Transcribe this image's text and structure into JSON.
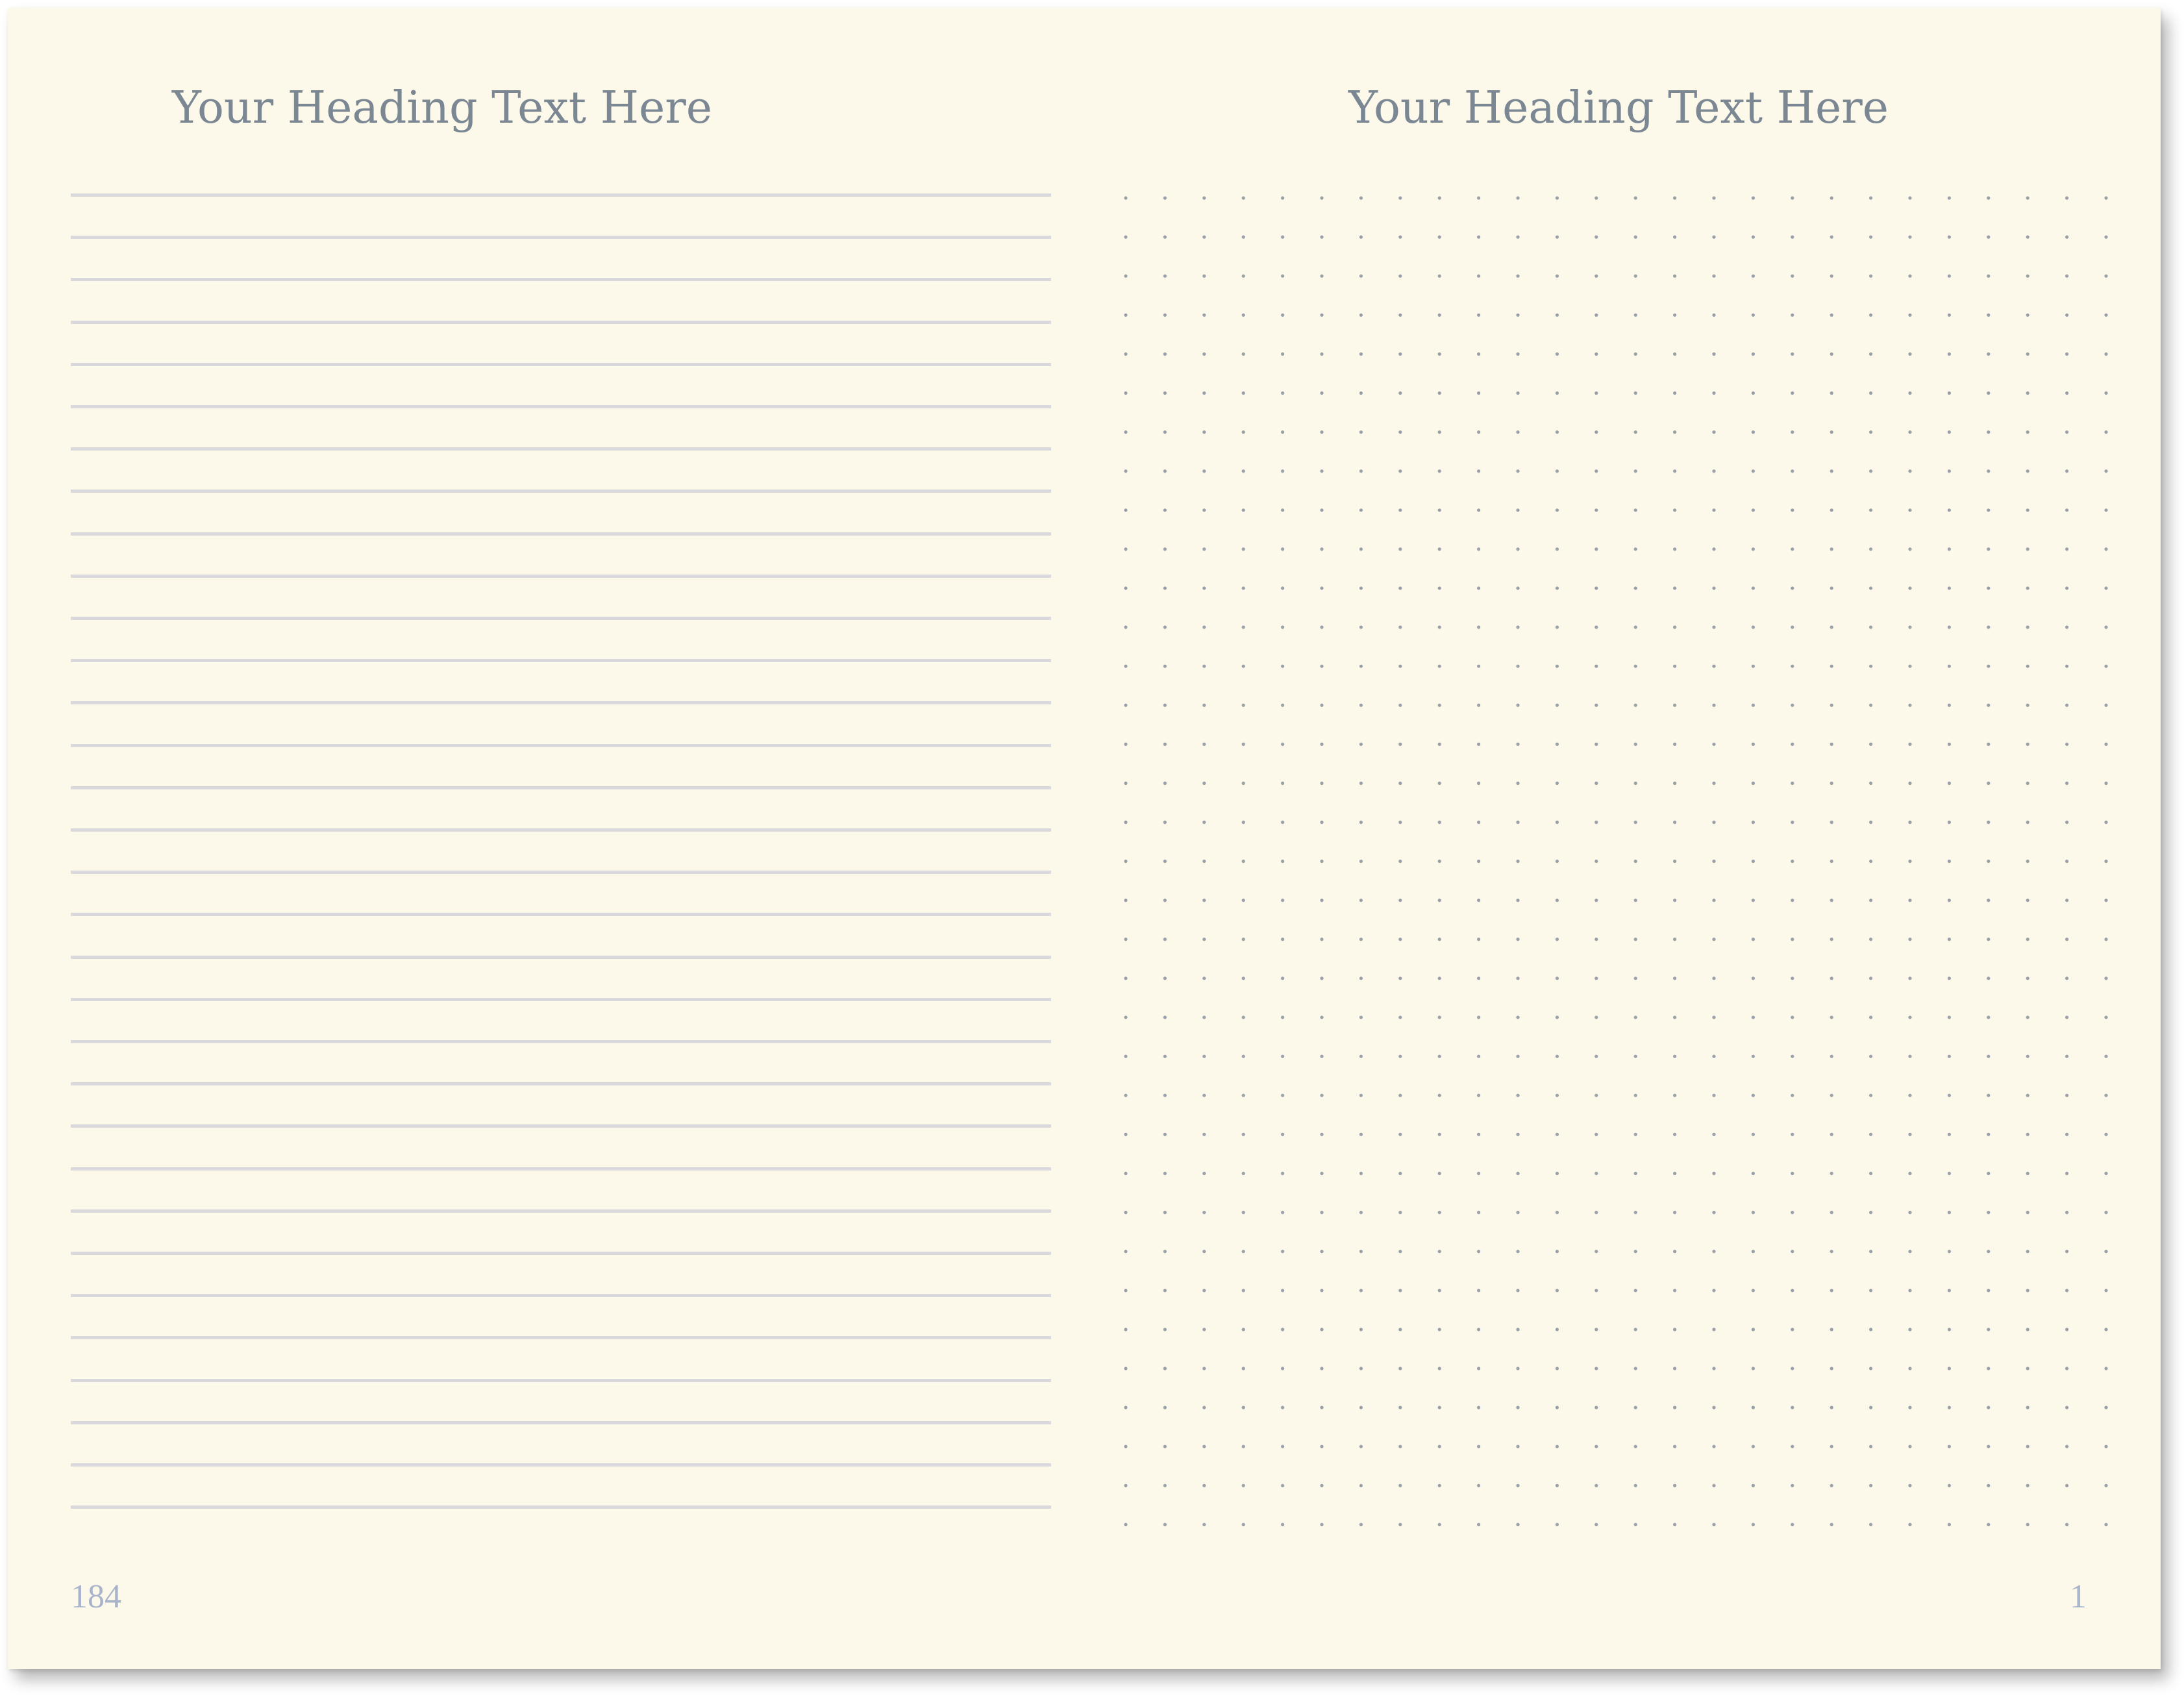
{
  "spread": {
    "left_page": {
      "heading": "Your Heading Text Here",
      "page_number": "184",
      "layout": "lined",
      "line_count": 32,
      "line_color": "#d9d9dd"
    },
    "right_page": {
      "heading": "Your Heading Text Here",
      "page_number": "1",
      "layout": "dot-grid",
      "dot_columns": 26,
      "dot_rows": 35,
      "dot_color": "#9aa0a8"
    },
    "colors": {
      "paper": "#fdf9ea",
      "heading": "#7b8894",
      "page_number": "#a8b4cc"
    }
  }
}
